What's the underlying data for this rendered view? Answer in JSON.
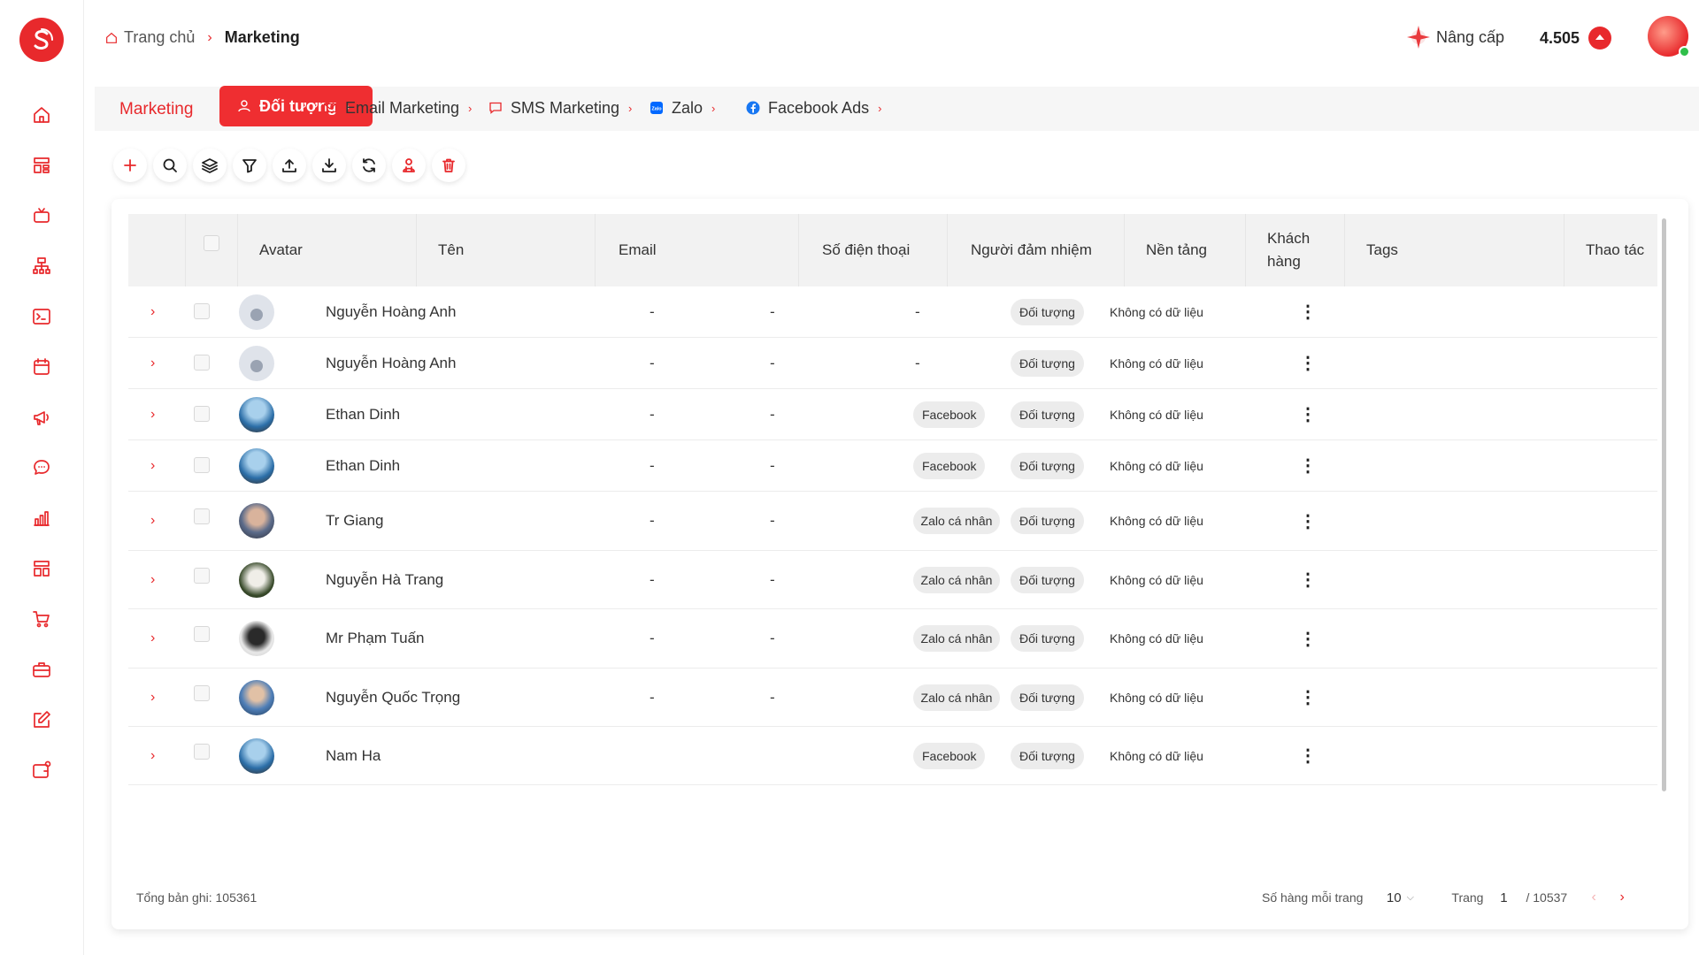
{
  "header": {
    "breadcrumb_home": "Trang chủ",
    "breadcrumb_current": "Marketing",
    "upgrade_label": "Nâng cấp",
    "points": "4.505"
  },
  "tabs": {
    "marketing": "Marketing",
    "audience": "Đối tượng",
    "email": "Email Marketing",
    "sms": "SMS Marketing",
    "zalo": "Zalo",
    "facebook": "Facebook Ads"
  },
  "colors": {
    "accent": "#e8292c",
    "header_bg": "#f2f2f2",
    "pill_bg": "#ececec"
  },
  "sidebar_icons": [
    "home-icon",
    "dashboard-icon",
    "tv-icon",
    "sitemap-icon",
    "terminal-icon",
    "calendar-icon",
    "megaphone-icon",
    "chat-icon",
    "bar-chart-icon",
    "layout-icon",
    "cart-icon",
    "briefcase-icon",
    "edit-icon",
    "wallet-icon"
  ],
  "toolbar_icons": [
    "plus-icon",
    "search-icon",
    "layers-icon",
    "filter-icon",
    "upload-icon",
    "download-icon",
    "refresh-icon",
    "merge-users-icon",
    "trash-icon"
  ],
  "table": {
    "headers": {
      "avatar": "Avatar",
      "name": "Tên",
      "email": "Email",
      "phone": "Số điện thoại",
      "owner": "Người đảm nhiệm",
      "platform": "Nền tảng",
      "customer": "Khách hàng",
      "tags": "Tags",
      "actions": "Thao tác"
    },
    "rows": [
      {
        "name": "Nguyễn Hoàng Anh",
        "phone": "-",
        "owner": "-",
        "platform_text": "-",
        "platform": "",
        "customer": "Đối tượng",
        "tags": "Không có dữ liệu"
      },
      {
        "name": "Nguyễn Hoàng Anh",
        "phone": "-",
        "owner": "-",
        "platform_text": "-",
        "platform": "",
        "customer": "Đối tượng",
        "tags": "Không có dữ liệu"
      },
      {
        "name": "Ethan Dinh",
        "phone": "-",
        "owner": "-",
        "platform_text": "",
        "platform": "Facebook",
        "customer": "Đối tượng",
        "tags": "Không có dữ liệu"
      },
      {
        "name": "Ethan Dinh",
        "phone": "-",
        "owner": "-",
        "platform_text": "",
        "platform": "Facebook",
        "customer": "Đối tượng",
        "tags": "Không có dữ liệu"
      },
      {
        "name": "Tr Giang",
        "phone": "-",
        "owner": "-",
        "platform_text": "",
        "platform": "Zalo cá nhân",
        "customer": "Đối tượng",
        "tags": "Không có dữ liệu"
      },
      {
        "name": "Nguyễn Hà Trang",
        "phone": "-",
        "owner": "-",
        "platform_text": "",
        "platform": "Zalo cá nhân",
        "customer": "Đối tượng",
        "tags": "Không có dữ liệu"
      },
      {
        "name": "Mr Phạm Tuấn",
        "phone": "-",
        "owner": "-",
        "platform_text": "",
        "platform": "Zalo cá nhân",
        "customer": "Đối tượng",
        "tags": "Không có dữ liệu"
      },
      {
        "name": "Nguyễn Quốc Trọng",
        "phone": "-",
        "owner": "-",
        "platform_text": "",
        "platform": "Zalo cá nhân",
        "customer": "Đối tượng",
        "tags": "Không có dữ liệu"
      },
      {
        "name": "Nam Ha",
        "phone": "",
        "owner": "",
        "platform_text": "",
        "platform": "Facebook",
        "customer": "Đối tượng",
        "tags": "Không có dữ liệu"
      }
    ]
  },
  "footer": {
    "total": "Tổng bản ghi: 105361",
    "rows_per_page_label": "Số hàng mỗi trang",
    "rows_per_page": "10",
    "page_label": "Trang",
    "page": "1",
    "page_total": "/ 10537"
  }
}
